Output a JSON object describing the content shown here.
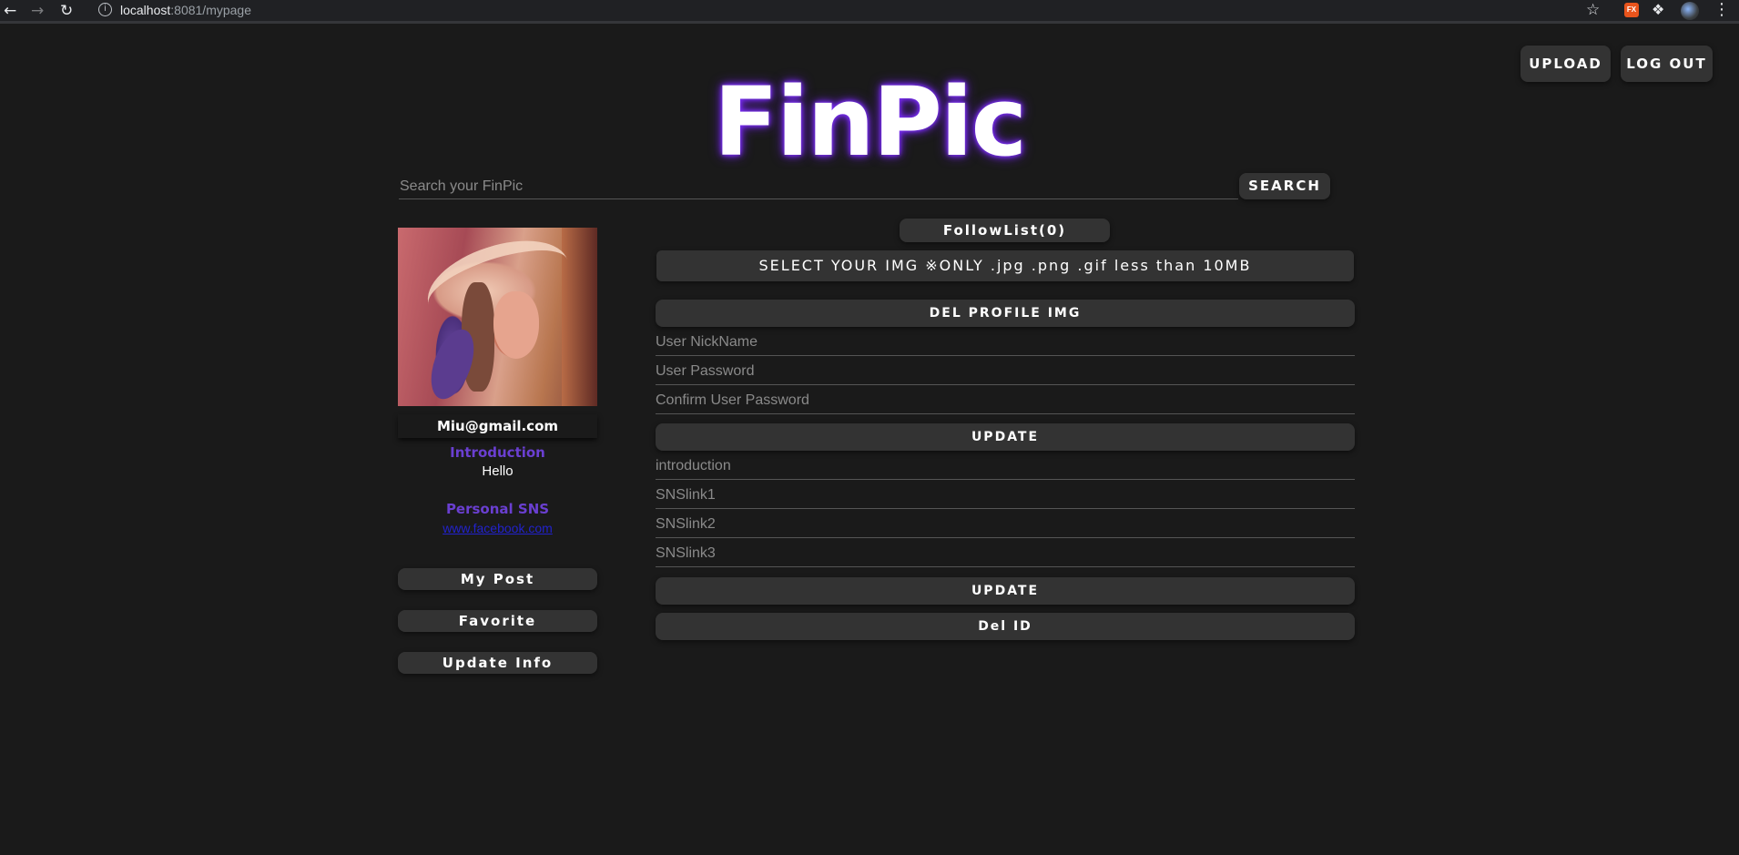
{
  "browser": {
    "url_host": "localhost",
    "url_rest": ":8081/mypage",
    "icons": [
      "back-arrow-icon",
      "forward-arrow-icon",
      "reload-icon",
      "info-icon",
      "star-icon",
      "fx-extension-icon",
      "puzzle-icon",
      "profile-avatar",
      "more-menu-icon"
    ]
  },
  "header": {
    "upload_label": "UPLOAD",
    "logout_label": "LOG OUT",
    "logo_text": "FinPic",
    "logo_glow_color": "#7b2ff7"
  },
  "search": {
    "placeholder": "Search your FinPic",
    "button_label": "SEARCH"
  },
  "profile": {
    "email": "Miu@gmail.com",
    "introduction_label": "Introduction",
    "introduction_text": "Hello",
    "sns_label": "Personal SNS",
    "sns_link": "www.facebook.com",
    "label_color": "#6a3fd1"
  },
  "sidebar": {
    "items": [
      {
        "label": "My Post"
      },
      {
        "label": "Favorite"
      },
      {
        "label": "Update Info"
      }
    ]
  },
  "settings": {
    "follow_label": "FollowList(0)",
    "select_img_label": "SELECT YOUR IMG ※ONLY .jpg .png .gif less than 10MB",
    "del_profile_label": "DEL PROFILE IMG",
    "nickname_placeholder": "User NickName",
    "password_placeholder": "User Password",
    "confirm_placeholder": "Confirm User Password",
    "update_label_1": "UPDATE",
    "introduction_placeholder": "introduction",
    "sns1_placeholder": "SNSlink1",
    "sns2_placeholder": "SNSlink2",
    "sns3_placeholder": "SNSlink3",
    "update_label_2": "UPDATE",
    "del_id_label": "Del ID"
  }
}
